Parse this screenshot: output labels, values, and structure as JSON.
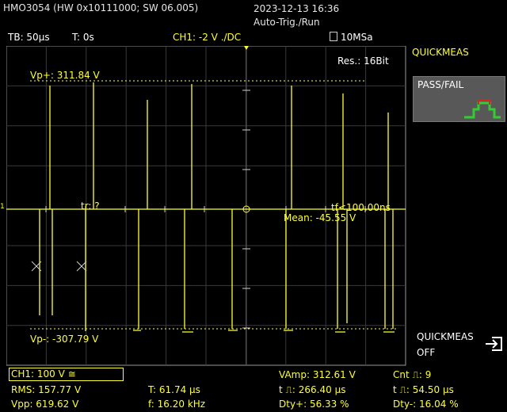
{
  "header": {
    "title": "HMO3054 (HW 0x10111000; SW 06.005)",
    "datetime": "2023-12-13 16:36",
    "trigger_status": "Auto-Trig./Run"
  },
  "infobar": {
    "timebase": "TB: 50µs",
    "trigger_time": "T: 0s",
    "ch1_setting": "CH1: -2 V ./DC",
    "sample_rate": "10MSa"
  },
  "screen": {
    "resolution": "Res.: 16Bit",
    "vp_plus": "Vp+: 311.84 V",
    "vp_minus": "Vp-: -307.79 V",
    "tr": "tr: ?",
    "tf": "tf<100.00ns",
    "mean": "Mean: -45.55 V",
    "trace_color": "#ffff33",
    "ground_marker": "1"
  },
  "softmenu": {
    "title": "QUICKMEAS",
    "passfail_label": "PASS/FAIL",
    "quickmeas_off_line1": "QUICKMEAS",
    "quickmeas_off_line2": "OFF"
  },
  "bottom": {
    "ch1_status": "CH1: 100 V ≅",
    "rms": "RMS: 157.77 V",
    "vpp": "Vpp: 619.62 V",
    "period": "T: 61.74 µs",
    "frequency": "f: 16.20 kHz",
    "vamp": "VAmp: 312.61 V",
    "pos_width": "t ⎍: 266.40 µs",
    "duty_pos": "Dty+: 56.33 %",
    "count": "Cnt ⎍: 9",
    "neg_width": "t ⎍: 54.50 µs",
    "duty_neg": "Dty-: 16.04 %"
  }
}
